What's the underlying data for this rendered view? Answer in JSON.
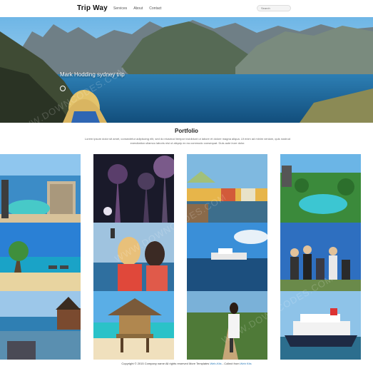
{
  "header": {
    "brand": "Trip Way",
    "nav": [
      "Services",
      "About",
      "Contact"
    ],
    "search_placeholder": "Search"
  },
  "hero": {
    "caption": "Mark Hodding sydney trip",
    "slides": 3,
    "active_slide": 0
  },
  "portfolio": {
    "title": "Portfolio",
    "description": "Lorem ipsum dolor sit amet, consectetur adipiscing elit, sed do eiusmod tempor incididunt ut labore et dolore magna aliqua. Ut enim ad minim veniam, quis nostrud exercitation ullamco laboris nisi ut aliquip ex ea commodo consequat. Duis aute irure dolor."
  },
  "gallery": {
    "columns": [
      [
        "resort-hotel-pool",
        "palm-beach",
        "seaside-harbor"
      ],
      [
        "garden-supertrees",
        "women-selfie",
        "beach-hut"
      ],
      [
        "waterfront-town",
        "boat-on-sea",
        "woman-on-path"
      ],
      [
        "tropical-resort",
        "hikers-group",
        "cruise-ship"
      ]
    ]
  },
  "footer": {
    "text": "Copyright © 2015 Company name All rights reserved More Templates",
    "link1": "Web-Kits",
    "mid": "- Collect from",
    "link2": "Web Kits"
  },
  "watermark": "WWW.DOWNCODES.COM",
  "colors": {
    "sky": "#5aa6d8",
    "sea": "#1f6fa8",
    "link": "#2a7ab8"
  }
}
